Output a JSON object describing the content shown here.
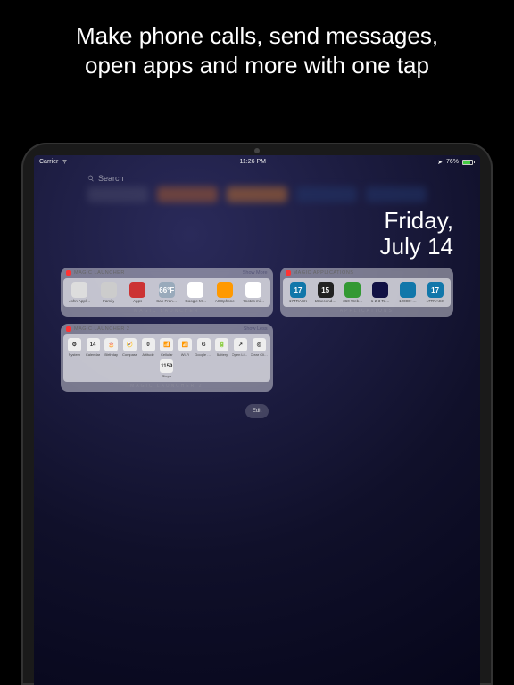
{
  "promo": {
    "line1": "Make phone calls, send messages,",
    "line2": "open apps and more with one tap"
  },
  "status": {
    "carrier": "Carrier",
    "time": "11:26 PM",
    "battery_pct": "76%"
  },
  "search": {
    "placeholder": "Search"
  },
  "date": {
    "weekday": "Friday,",
    "month_day": "July 14"
  },
  "widgets": {
    "launcher1": {
      "title": "MAGIC LAUNCHER",
      "action": "Show More",
      "footer": "MAGIC LAUNCHER",
      "items": [
        {
          "label": "John Appl…",
          "bg": "#ddd"
        },
        {
          "label": "Family",
          "bg": "#ccc"
        },
        {
          "label": "Apps",
          "bg": "#c33"
        },
        {
          "label": "San Fran…",
          "bg": "#9ab",
          "text": "66°F"
        },
        {
          "label": "Google M…",
          "bg": "#fff"
        },
        {
          "label": "AGEphone",
          "bg": "#f90"
        },
        {
          "label": "7notes mi…",
          "bg": "#fff"
        }
      ]
    },
    "applications": {
      "title": "MAGIC APPLICATIONS",
      "footer": "APPLICATIONS",
      "items": [
        {
          "label": "17TRACK",
          "bg": "#17a",
          "text": "17"
        },
        {
          "label": "15second…",
          "bg": "#222",
          "text": "15"
        },
        {
          "label": "360 Web…",
          "bg": "#393"
        },
        {
          "label": "1-2-3 Ta…",
          "bg": "#114"
        },
        {
          "label": "12000+…",
          "bg": "#17a"
        },
        {
          "label": "17TRACK",
          "bg": "#17a",
          "text": "17"
        }
      ]
    },
    "launcher2": {
      "title": "MAGIC LAUNCHER 2",
      "action": "Show Less",
      "footer": "MAGIC LAUNCHER 2",
      "items": [
        {
          "label": "System",
          "icon": "⚙"
        },
        {
          "label": "Calendar",
          "icon": "14"
        },
        {
          "label": "Birthday",
          "icon": "🎂"
        },
        {
          "label": "Compass",
          "icon": "🧭"
        },
        {
          "label": "Altitude",
          "icon": "0"
        },
        {
          "label": "Cellular",
          "icon": "📶"
        },
        {
          "label": "Wi-Fi",
          "icon": "📶"
        },
        {
          "label": "Google S…",
          "icon": "G"
        },
        {
          "label": "Battery",
          "icon": "🔋"
        },
        {
          "label": "Open Lin…",
          "icon": "↗"
        },
        {
          "label": "Clear Cli…",
          "icon": "◎"
        },
        {
          "label": "Steps",
          "icon": "1159"
        }
      ]
    }
  },
  "edit_label": "Edit"
}
